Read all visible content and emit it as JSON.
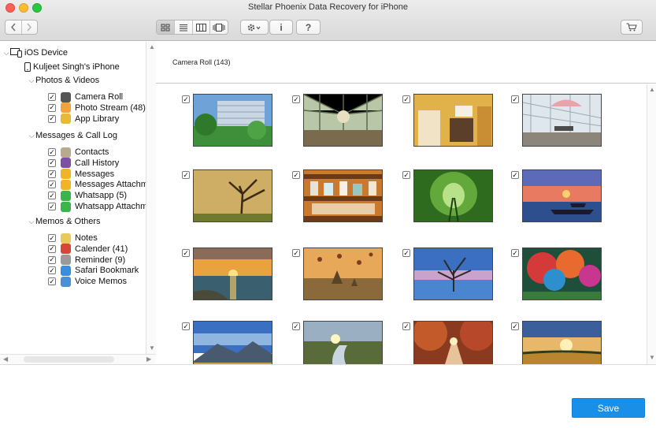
{
  "window": {
    "title": "Stellar Phoenix Data Recovery for iPhone"
  },
  "toolbar": {
    "back_icon": "chevron-left-icon",
    "forward_icon": "chevron-right-icon",
    "views": [
      "grid-view-icon",
      "list-view-icon",
      "column-view-icon",
      "coverflow-view-icon"
    ],
    "settings_icon": "gear-icon",
    "info_label": "i",
    "help_label": "?",
    "cart_icon": "cart-icon"
  },
  "sidebar": {
    "root": "iOS Device",
    "device": "Kuljeet Singh's iPhone",
    "groups": [
      {
        "label": "Photos & Videos",
        "items": [
          {
            "label": "Camera Roll",
            "icon": "camera-icon",
            "color": "#555555"
          },
          {
            "label": "Photo Stream (48)",
            "icon": "photo-stream-icon",
            "color": "#f2a23a"
          },
          {
            "label": "App Library",
            "icon": "app-library-icon",
            "color": "#e8b83a"
          }
        ]
      },
      {
        "label": "Messages & Call Log",
        "items": [
          {
            "label": "Contacts",
            "icon": "contacts-icon",
            "color": "#b9a98f"
          },
          {
            "label": "Call History",
            "icon": "call-history-icon",
            "color": "#7e4fa6"
          },
          {
            "label": "Messages",
            "icon": "messages-icon",
            "color": "#f0b429"
          },
          {
            "label": "Messages Attachme",
            "icon": "messages-attachment-icon",
            "color": "#f0b429"
          },
          {
            "label": "Whatsapp (5)",
            "icon": "whatsapp-icon",
            "color": "#3bb54a"
          },
          {
            "label": "Whatsapp Attachme",
            "icon": "whatsapp-attachment-icon",
            "color": "#3bb54a"
          }
        ]
      },
      {
        "label": "Memos & Others",
        "items": [
          {
            "label": "Notes",
            "icon": "notes-icon",
            "color": "#e9c95a"
          },
          {
            "label": "Calender (41)",
            "icon": "calendar-icon",
            "color": "#d6453a"
          },
          {
            "label": "Reminder (9)",
            "icon": "reminder-icon",
            "color": "#9a9a9a"
          },
          {
            "label": "Safari Bookmark",
            "icon": "safari-icon",
            "color": "#3a8fd8"
          },
          {
            "label": "Voice Memos",
            "icon": "voice-memos-icon",
            "color": "#4a90d9"
          }
        ]
      }
    ]
  },
  "main": {
    "breadcrumb": "Camera Roll (143)",
    "photos": [
      {
        "name": "office-building-photo",
        "scene": "building"
      },
      {
        "name": "conservatory-cafe-photo",
        "scene": "glasshouse"
      },
      {
        "name": "interior-room-photo",
        "scene": "interior"
      },
      {
        "name": "terrace-umbrella-photo",
        "scene": "terrace"
      },
      {
        "name": "misty-tree-photo",
        "scene": "misty"
      },
      {
        "name": "shelves-jars-photo",
        "scene": "shelves"
      },
      {
        "name": "green-tunnel-photo",
        "scene": "tunnel"
      },
      {
        "name": "sunset-boats-photo",
        "scene": "boats"
      },
      {
        "name": "sunset-sea-photo",
        "scene": "sunsetsea"
      },
      {
        "name": "balloons-temples-photo",
        "scene": "balloons"
      },
      {
        "name": "dead-tree-lake-photo",
        "scene": "deadtree"
      },
      {
        "name": "colorful-trees-photo",
        "scene": "colortrees"
      },
      {
        "name": "mountain-valley-photo",
        "scene": "mountain"
      },
      {
        "name": "stream-sunrise-photo",
        "scene": "stream"
      },
      {
        "name": "autumn-road-photo",
        "scene": "autumn"
      },
      {
        "name": "golden-field-photo",
        "scene": "field"
      }
    ]
  },
  "footer": {
    "save_label": "Save"
  }
}
